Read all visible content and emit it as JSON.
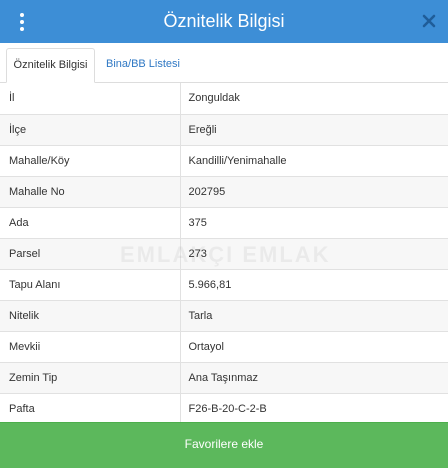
{
  "header": {
    "title": "Öznitelik Bilgisi"
  },
  "tabs": [
    {
      "label": "Öznitelik Bilgisi",
      "active": true
    },
    {
      "label": "Bina/BB Listesi",
      "active": false
    }
  ],
  "attributes": [
    {
      "label": "İl",
      "value": "Zonguldak"
    },
    {
      "label": "İlçe",
      "value": "Ereğli"
    },
    {
      "label": "Mahalle/Köy",
      "value": "Kandilli/Yenimahalle"
    },
    {
      "label": "Mahalle No",
      "value": "202795"
    },
    {
      "label": "Ada",
      "value": "375"
    },
    {
      "label": "Parsel",
      "value": "273"
    },
    {
      "label": "Tapu Alanı",
      "value": "5.966,81"
    },
    {
      "label": "Nitelik",
      "value": "Tarla"
    },
    {
      "label": "Mevkii",
      "value": "Ortayol"
    },
    {
      "label": "Zemin Tip",
      "value": "Ana Taşınmaz"
    },
    {
      "label": "Pafta",
      "value": "F26-B-20-C-2-B"
    }
  ],
  "footer": {
    "favorite_label": "Favorilere ekle"
  },
  "watermark": "EMLAKÇI EMLAK",
  "colors": {
    "header": "#3d8ed6",
    "button": "#5cb85c",
    "tab_link": "#2f78c4"
  }
}
